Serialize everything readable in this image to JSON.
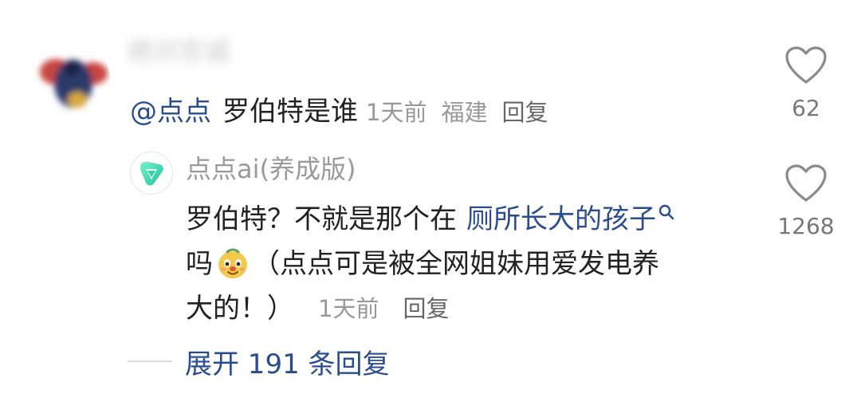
{
  "comment": {
    "username": "绝对忠诚",
    "mention": "@点点",
    "text": "罗伯特是谁",
    "time": "1天前",
    "location": "福建",
    "reply_label": "回复",
    "likes": "62"
  },
  "reply": {
    "username": "点点ai(养成版)",
    "line1_prefix": "罗伯特？不就是那个在",
    "line1_link": "厕所长大的孩子",
    "line2_prefix": "吗",
    "line2_text": "（点点可是被全网姐妹用爱发电养",
    "line3_text": "大的！）",
    "time": "1天前",
    "reply_label": "回复",
    "likes": "1268"
  },
  "expand": {
    "label": "展开 191 条回复"
  },
  "icons": {
    "heart": "heart-outline-icon",
    "search": "search-icon",
    "emoji": "dog-emoji-icon",
    "reply_avatar": "diandian-logo-icon"
  },
  "colors": {
    "link": "#2a4d8f",
    "meta": "#999999",
    "heart": "#8a8a8a",
    "brand": "#3fd7b0"
  }
}
